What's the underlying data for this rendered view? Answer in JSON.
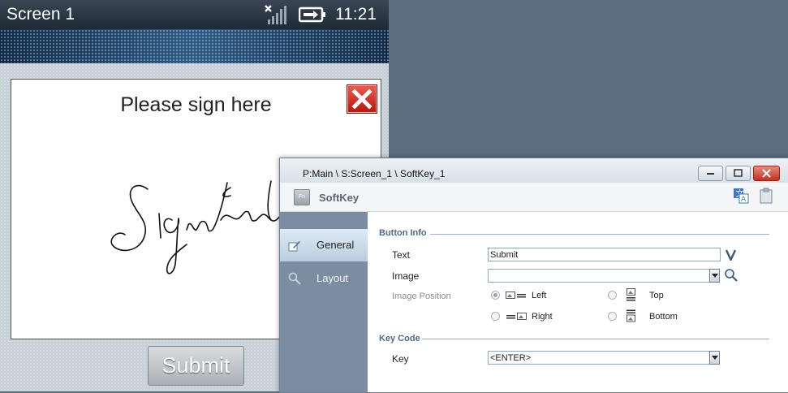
{
  "device": {
    "screen_title": "Screen 1",
    "time": "11:21",
    "signal_icon": "signal-off-icon",
    "battery_icon": "battery-charging-icon",
    "sign_prompt": "Please sign here",
    "signature_text": "Signature",
    "submit_label": "Submit"
  },
  "dialog": {
    "path": "P:Main \\ S:Screen_1 \\ SoftKey_1",
    "heading": "SoftKey",
    "fn_badge": "Fn",
    "nav": [
      {
        "label": "General",
        "icon": "edit-icon",
        "selected": true
      },
      {
        "label": "Layout",
        "icon": "zoom-icon",
        "selected": false
      }
    ],
    "button_info": {
      "section_title": "Button Info",
      "text_label": "Text",
      "text_value": "Submit",
      "image_label": "Image",
      "image_value": "",
      "image_position_label": "Image Position",
      "positions": {
        "left": "Left",
        "right": "Right",
        "top": "Top",
        "bottom": "Bottom"
      },
      "selected_position": "Left"
    },
    "key_code": {
      "section_title": "Key Code",
      "key_label": "Key",
      "key_value": "<ENTER>"
    }
  }
}
